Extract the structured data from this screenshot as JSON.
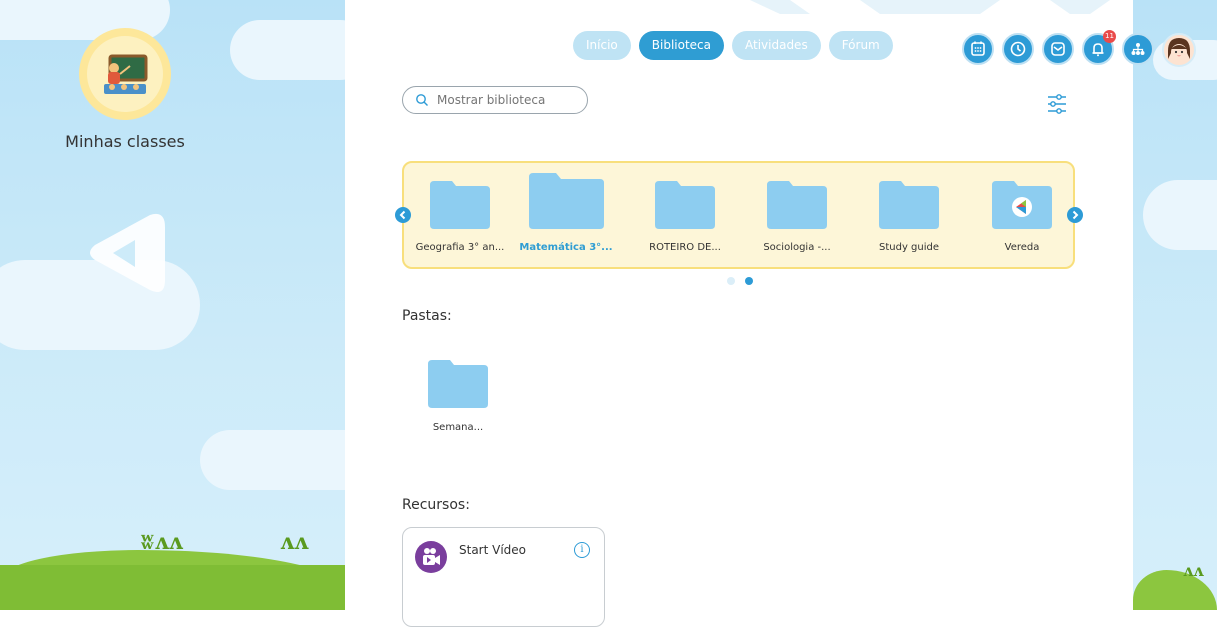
{
  "sidebar": {
    "title": "Minhas classes"
  },
  "nav": {
    "tabs": [
      {
        "label": "Início",
        "active": false
      },
      {
        "label": "Biblioteca",
        "active": true
      },
      {
        "label": "Atividades",
        "active": false
      },
      {
        "label": "Fórum",
        "active": false
      }
    ]
  },
  "header_icons": {
    "items": [
      "calendar-icon",
      "clock-icon",
      "mail-icon",
      "bell-icon",
      "sitemap-icon",
      "user-avatar"
    ],
    "notification_count": "11"
  },
  "search": {
    "placeholder": "Mostrar biblioteca",
    "value": ""
  },
  "carousel": {
    "folders": [
      {
        "label": "Geografia 3° an...",
        "active": false
      },
      {
        "label": "Matemática 3°...",
        "active": true
      },
      {
        "label": "ROTEIRO DE...",
        "active": false
      },
      {
        "label": "Sociologia -...",
        "active": false
      },
      {
        "label": "Study guide",
        "active": false
      },
      {
        "label": "Vereda",
        "active": false
      }
    ],
    "page_count": 2,
    "current_page": 2
  },
  "pastas": {
    "title": "Pastas:",
    "items": [
      {
        "label": "Semana..."
      }
    ]
  },
  "recursos": {
    "title": "Recursos:",
    "items": [
      {
        "label": "Start Vídeo"
      }
    ]
  },
  "colors": {
    "accent": "#2d9bd6",
    "tab_inactive": "#bfe3f4",
    "carousel_bg": "#fdf6d8",
    "carousel_border": "#f8df7c",
    "folder": "#8dcdf0"
  }
}
